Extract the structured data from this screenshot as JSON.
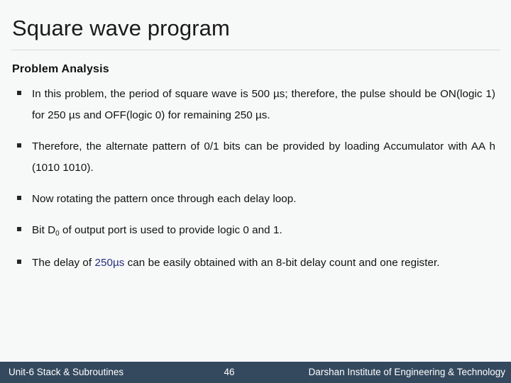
{
  "slide": {
    "title": "Square wave program",
    "section_heading": "Problem Analysis",
    "background_color": "#f7f8f8",
    "accent_color": "#25307f",
    "footer_color": "#34495e",
    "bullets": [
      {
        "id": "bullet-period",
        "line1": "In this problem, the period of square wave is 500 µs; therefore,",
        "line2": "the pulse should be ON(logic 1) for 250 µs and OFF(logic 0) for",
        "line3": "remaining 250 µs."
      },
      {
        "id": "bullet-pattern",
        "line1": "Therefore, the alternate pattern of 0/1 bits can be provided by",
        "line2": "loading Accumulator with AA h (1010 1010)."
      },
      {
        "id": "bullet-rotate",
        "line1": "Now rotating the pattern once through each delay loop."
      },
      {
        "id": "bullet-bit-d0",
        "prefix": "Bit D",
        "subscript": "0",
        "suffix": " of output port is used to provide logic 0  and 1."
      },
      {
        "id": "bullet-delay",
        "pre_accent": "The delay of ",
        "accent": "250µs",
        "post_accent": " can be easily obtained with an 8-bit delay",
        "line2": "count and one register."
      }
    ]
  },
  "footer": {
    "left": "Unit-6 Stack & Subroutines",
    "page": "46",
    "right": "Darshan Institute of Engineering & Technology"
  }
}
